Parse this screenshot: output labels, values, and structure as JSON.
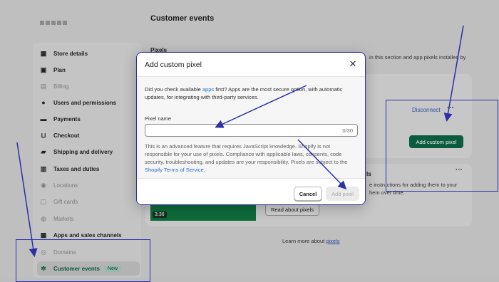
{
  "page": {
    "title": "Customer events",
    "section_label": "Pixels"
  },
  "sidebar": {
    "items": [
      {
        "label": "Store details",
        "icon": "store-icon",
        "state": "normal"
      },
      {
        "label": "Plan",
        "icon": "plan-icon",
        "state": "normal"
      },
      {
        "label": "Billing",
        "icon": "billing-icon",
        "state": "disabled"
      },
      {
        "label": "Users and permissions",
        "icon": "users-icon",
        "state": "normal"
      },
      {
        "label": "Payments",
        "icon": "payments-icon",
        "state": "normal"
      },
      {
        "label": "Checkout",
        "icon": "cart-icon",
        "state": "normal"
      },
      {
        "label": "Shipping and delivery",
        "icon": "truck-icon",
        "state": "normal"
      },
      {
        "label": "Taxes and duties",
        "icon": "taxes-icon",
        "state": "normal"
      },
      {
        "label": "Locations",
        "icon": "location-icon",
        "state": "disabled"
      },
      {
        "label": "Gift cards",
        "icon": "gift-card-icon",
        "state": "disabled"
      },
      {
        "label": "Markets",
        "icon": "globe-icon",
        "state": "disabled"
      },
      {
        "label": "Apps and sales channels",
        "icon": "apps-icon",
        "state": "normal"
      },
      {
        "label": "Domains",
        "icon": "domains-icon",
        "state": "disabled"
      },
      {
        "label": "Customer events",
        "icon": "customer-events-icon",
        "state": "active",
        "badge": "New"
      }
    ]
  },
  "background": {
    "description_snippet": "in this section and app pixels installed by",
    "disconnect_label": "Disconnect",
    "add_custom_pixel_label": "Add custom pixel",
    "section_heading_fragment": "ls",
    "instructions_snippet": [
      "e instructions for adding them to your",
      "hem over time."
    ],
    "video_duration": "3:36",
    "read_about_label": "Read about pixels",
    "learn_more_prefix": "Learn more about",
    "learn_more_link": "pixels"
  },
  "modal": {
    "title": "Add custom pixel",
    "intro_before": "Did you check available ",
    "intro_link": "apps",
    "intro_after": " first? Apps are the most secure option, with automatic updates, for integrating with third-party services.",
    "field_label": "Pixel name",
    "field_value": "",
    "field_placeholder": "",
    "counter": "0/30",
    "terms_text": "This is an advanced feature that requires JavaScript knowledge. Shopify is not responsible for your use of pixels. Compliance with applicable laws, consents, code security, troubleshooting, and updates are your responsibility. Pixels are subject to the",
    "terms_link": "Shopify Terms of Service",
    "terms_end": ".",
    "cancel_label": "Cancel",
    "add_label": "Add pixel"
  },
  "colors": {
    "accent_green": "#0b5b3f",
    "annotation_blue": "#2b2fa8",
    "link_blue": "#2c6ecb"
  }
}
